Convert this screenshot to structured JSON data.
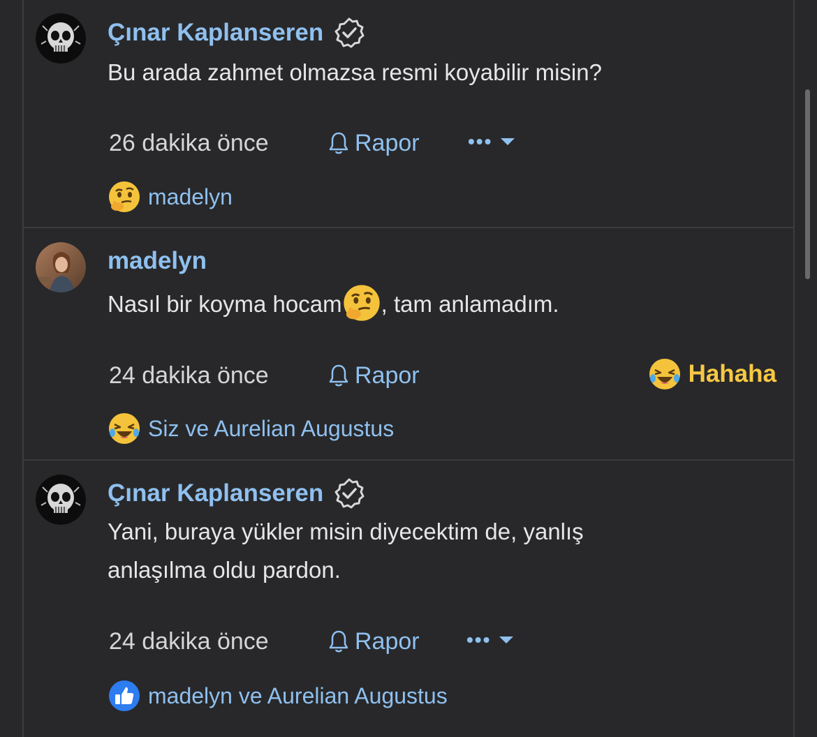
{
  "posts": [
    {
      "author": "Çınar Kaplanseren",
      "verified": true,
      "avatar": "skull-avatar",
      "text_lines": [
        "Bu arada zahmet olmazsa resmi koyabilir misin?"
      ],
      "time": "26 dakika önce",
      "report_label": "Rapor",
      "more": "•••",
      "reaction_icon": "thinking-emoji",
      "reaction_text": "madelyn"
    },
    {
      "author": "madelyn",
      "verified": false,
      "avatar": "woman-avatar",
      "text_before_emoji": "Nasıl bir koyma hocam",
      "text_after_emoji": ", tam anlamadım.",
      "time": "24 dakika önce",
      "report_label": "Rapor",
      "own_reaction_label": "Hahaha",
      "own_reaction_icon": "laughing-emoji",
      "reaction_icon": "laughing-emoji",
      "reaction_text": "Siz ve Aurelian Augustus"
    },
    {
      "author": "Çınar Kaplanseren",
      "verified": true,
      "avatar": "skull-avatar",
      "text_lines": [
        "Yani, buraya yükler misin diyecektim de, yanlış",
        "anlaşılma oldu pardon."
      ],
      "time": "24 dakika önce",
      "report_label": "Rapor",
      "more": "•••",
      "reaction_icon": "like-icon",
      "reaction_text": "madelyn ve Aurelian Augustus"
    }
  ],
  "colors": {
    "background": "#28282a",
    "link": "#8fc0ef",
    "text": "#e6e6e8",
    "haha": "#f7c844",
    "divider": "#3c3c3f"
  }
}
